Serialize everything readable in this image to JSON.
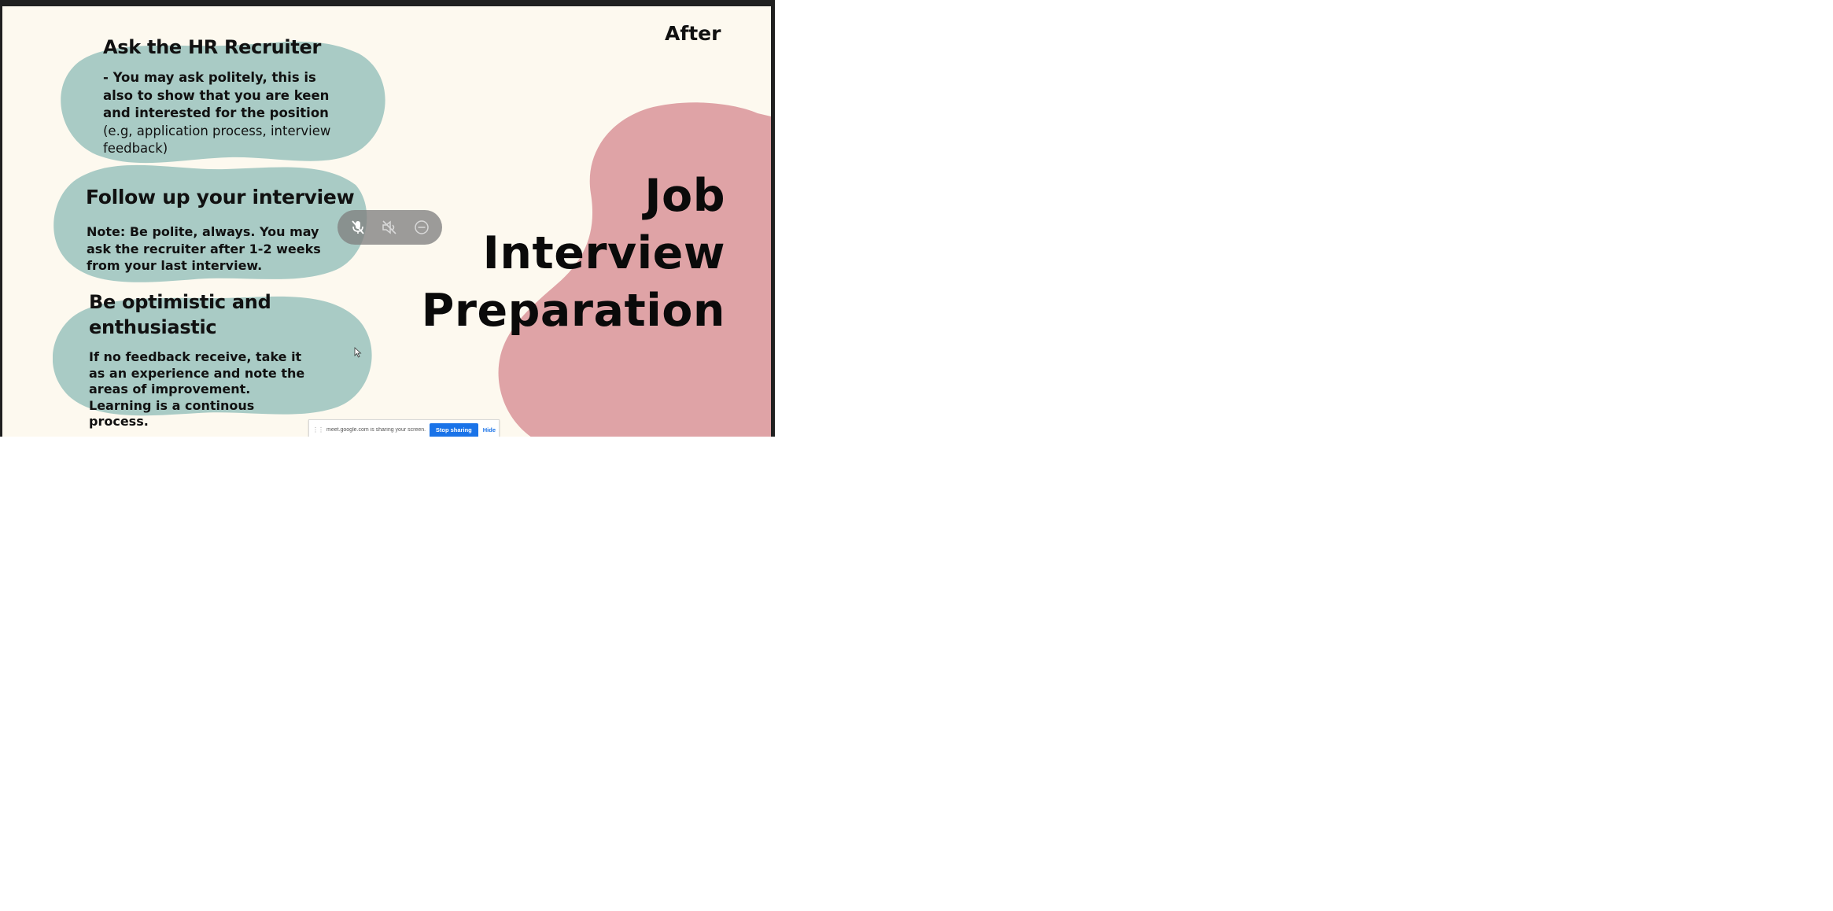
{
  "slide": {
    "after_label": "After",
    "title_lines": [
      "Job",
      "Interview",
      "Preparation"
    ],
    "sections": [
      {
        "heading": "Ask the HR Recruiter",
        "bold_text": "- You may ask politely, this is also to show that you are keen and interested for the position",
        "normal_text": "(e.g, application process, interview feedback)"
      },
      {
        "heading": "Follow up your interview",
        "bold_text": "Note: Be polite, always. You may ask the recruiter after 1-2 weeks from your last interview."
      },
      {
        "heading": "Be optimistic and enthusiastic",
        "bold_text": "If no feedback receive, take it as an experience and note the areas of improvement. Learning is a continous process."
      }
    ],
    "colors": {
      "background": "#fdf9ef",
      "teal_blob": "#a9cbc5",
      "pink_blob": "#dfa3a6",
      "text": "#111111"
    }
  },
  "meeting_controls": {
    "icons": [
      "mic-off-icon",
      "speaker-off-icon",
      "minus-circle-icon"
    ]
  },
  "share_bar": {
    "message": "meet.google.com is sharing your screen.",
    "stop_label": "Stop sharing",
    "hide_label": "Hide"
  }
}
